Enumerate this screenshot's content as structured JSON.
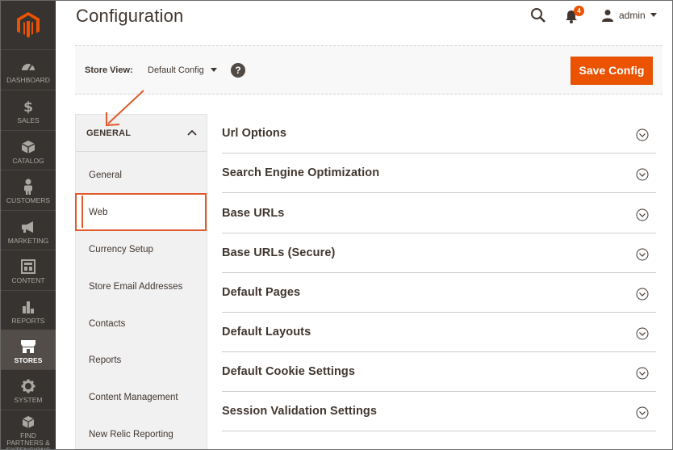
{
  "menu": {
    "items": [
      {
        "label": "DASHBOARD",
        "icon": "dashboard-icon"
      },
      {
        "label": "SALES",
        "icon": "dollar-icon"
      },
      {
        "label": "CATALOG",
        "icon": "box-icon"
      },
      {
        "label": "CUSTOMERS",
        "icon": "person-icon"
      },
      {
        "label": "MARKETING",
        "icon": "megaphone-icon"
      },
      {
        "label": "CONTENT",
        "icon": "layout-icon"
      },
      {
        "label": "REPORTS",
        "icon": "bar-chart-icon"
      },
      {
        "label": "STORES",
        "icon": "store-icon",
        "active": true
      },
      {
        "label": "SYSTEM",
        "icon": "gear-icon"
      },
      {
        "label": "FIND PARTNERS & EXTENSIONS",
        "icon": "cubes-icon"
      }
    ],
    "accent": "#eb5202"
  },
  "header": {
    "title": "Configuration",
    "notifications_count": "4",
    "user": "admin"
  },
  "store_bar": {
    "label": "Store View:",
    "value": "Default Config",
    "help": "?",
    "save_label": "Save Config"
  },
  "tabs": {
    "group_title": "GENERAL",
    "items": [
      {
        "label": "General"
      },
      {
        "label": "Web",
        "active": true
      },
      {
        "label": "Currency Setup"
      },
      {
        "label": "Store Email Addresses"
      },
      {
        "label": "Contacts"
      },
      {
        "label": "Reports"
      },
      {
        "label": "Content Management"
      },
      {
        "label": "New Relic Reporting"
      }
    ]
  },
  "sections": [
    {
      "title": "Url Options"
    },
    {
      "title": "Search Engine Optimization"
    },
    {
      "title": "Base URLs"
    },
    {
      "title": "Base URLs (Secure)"
    },
    {
      "title": "Default Pages"
    },
    {
      "title": "Default Layouts"
    },
    {
      "title": "Default Cookie Settings"
    },
    {
      "title": "Session Validation Settings"
    }
  ],
  "colors": {
    "sidebar_bg": "#373330",
    "primary_button": "#eb5202",
    "highlight": "#e05a2b",
    "text": "#41362f"
  }
}
